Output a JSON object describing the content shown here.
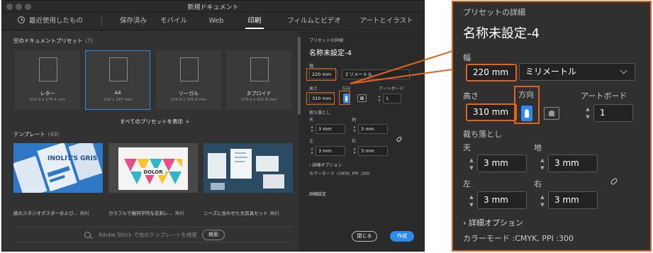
{
  "window": {
    "title": "新規ドキュメント"
  },
  "tabs": [
    {
      "label": "最近使用したもの"
    },
    {
      "label": "保存済み"
    },
    {
      "label": "モバイル"
    },
    {
      "label": "Web"
    },
    {
      "label": "印刷",
      "active": true
    },
    {
      "label": "フィルムとビデオ"
    },
    {
      "label": "アートとイラスト"
    }
  ],
  "presets_section": {
    "title": "空のドキュメントプリセット",
    "count": "(7)"
  },
  "presets": [
    {
      "name": "レター",
      "size": "215.9 x 279.4 mm"
    },
    {
      "name": "A4",
      "size": "210 x 297 mm",
      "selected": true
    },
    {
      "name": "リーガル",
      "size": "215.9 x 355.6 mm"
    },
    {
      "name": "タブロイド",
      "size": "279.4 x 431.8 mm"
    }
  ],
  "all_presets_label": "すべてのプリセットを表示 ＋",
  "templates_section": {
    "title": "テンプレート",
    "count": "(49)"
  },
  "templates": [
    {
      "caption": "紙のスタジオポスターおよび...",
      "price": "無料",
      "art_text": "INOLIT'S GRIS"
    },
    {
      "caption": "カラフルで幾何学的な名刺レ...",
      "price": "無料",
      "art_text": "DOLOR"
    },
    {
      "caption": "ニーズに合わせた文房具セット",
      "price": "無料",
      "art_text": ""
    }
  ],
  "search": {
    "placeholder": "Adobe Stock で他のテンプレートを検索",
    "button": "検索"
  },
  "preset_details": {
    "header": "プリセットの詳細",
    "name": "名称未設定-4",
    "width_label": "幅",
    "width": "220 mm",
    "unit": "ミリメートル",
    "height_label": "高さ",
    "height": "310 mm",
    "orientation_label": "方向",
    "artboard_label": "アートボード",
    "artboards": "1",
    "bleed_label": "裁ち落とし",
    "bleed_top_label": "天",
    "bleed_bottom_label": "地",
    "bleed_left_label": "左",
    "bleed_right_label": "右",
    "bleed_top": "3 mm",
    "bleed_bottom": "3 mm",
    "bleed_left": "3 mm",
    "bleed_right": "3 mm",
    "advanced_label": "詳細オプション",
    "color_mode": "カラーモード :CMYK, PPI :300",
    "detail_settings": "詳細設定",
    "close_button": "閉じる",
    "create_button": "作成"
  },
  "colors": {
    "accent": "#2d8ceb",
    "highlight": "#e0641c",
    "bg": "#323232"
  }
}
